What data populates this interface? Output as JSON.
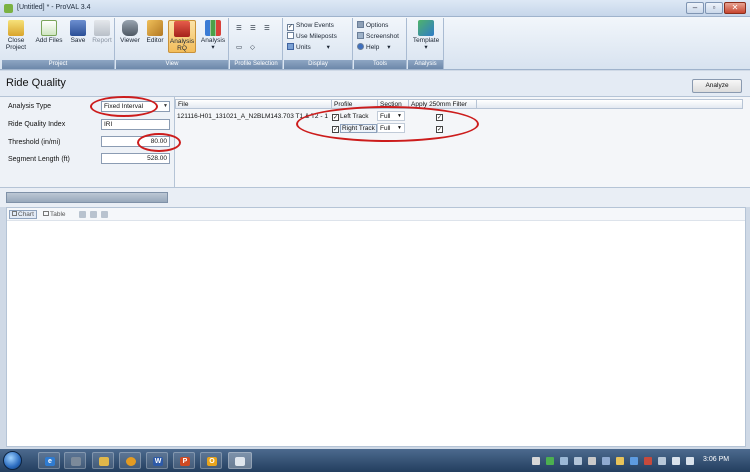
{
  "window": {
    "title": "[Untitled] * - ProVAL 3.4"
  },
  "ribbon": {
    "groups": {
      "project": "Project",
      "view": "View",
      "profile_selection": "Profile Selection",
      "display": "Display",
      "tools": "Tools",
      "analysis": "Analysis"
    },
    "close_project": [
      "Close",
      "Project"
    ],
    "add_files": "Add Files",
    "save": "Save",
    "report": "Report",
    "viewer": "Viewer",
    "editor": "Editor",
    "analysis_rq": [
      "Analysis",
      "RQ"
    ],
    "analysis": "Analysis",
    "show_events": "Show Events",
    "use_mileposts": "Use Mileposts",
    "units": "Units",
    "options": "Options",
    "screenshot": "Screenshot",
    "help": "Help",
    "template": "Template"
  },
  "header": {
    "title": "Ride Quality",
    "analyze_button": "Analyze"
  },
  "params": {
    "analysis_type_label": "Analysis Type",
    "analysis_type_value": "Fixed Interval",
    "rqi_label": "Ride Quality Index",
    "rqi_value": "IRI",
    "threshold_label": "Threshold (in/mi)",
    "threshold_value": "80.00",
    "segment_label": "Segment Length (ft)",
    "segment_value": "528.00"
  },
  "file_table": {
    "headers": [
      "File",
      "Profile",
      "Section",
      "Apply 250mm Filter"
    ],
    "file_name": "121116-H01_131021_A_N2BLM143.703 T1 & T2 - 1",
    "rows": [
      {
        "profile": "Left Track",
        "section": "Full",
        "checked": true
      },
      {
        "profile": "Right Track",
        "section": "Full",
        "checked": true
      }
    ]
  },
  "chart_toolbar": {
    "chart_tab": "Chart",
    "table_tab": "Table"
  },
  "taskbar": {
    "clock": "3:06 PM"
  },
  "colors": {
    "annotation": "#cc1c1c",
    "ribbon_active": "#f3bd5a"
  }
}
